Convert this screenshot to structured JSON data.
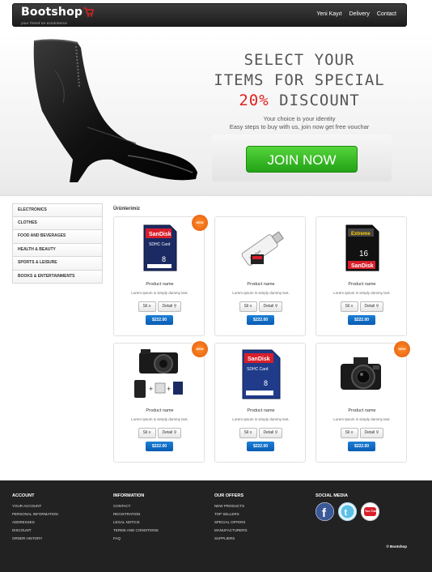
{
  "navbar": {
    "brand": "Bootshop",
    "tagline": "your friend on ecommerce",
    "links": [
      "Yeni Kayıt",
      "Delivery",
      "Contact"
    ]
  },
  "hero": {
    "line1": "SELECT YOUR",
    "line2": "ITEMS FOR SPECIAL",
    "line3_highlight": "20%",
    "line3_rest": " DISCOUNT",
    "sub1": "Your choice is your identity",
    "sub2": "Easy steps to buy with us, join now get free vouchar",
    "join_label": "JOIN NOW"
  },
  "sidebar": {
    "items": [
      "ELECTRONICS",
      "CLOTHES",
      "FOOD AND BEVERAGES",
      "HEALTH & BEAUTY",
      "SPORTS & LEISURE",
      "BOOKS & ENTERTAINMENTS"
    ]
  },
  "products": {
    "title": "Ürünlerimiz",
    "new_label": "NEW",
    "items": [
      {
        "name": "Product name",
        "desc": "Lorem Ipsum is simply dummy text.",
        "sil": "Sil",
        "detail": "Detail",
        "price": "$222.00",
        "new": true,
        "icon": "sd-card-icon"
      },
      {
        "name": "Product name",
        "desc": "Lorem Ipsum is simply dummy text.",
        "sil": "Sil",
        "detail": "Detail",
        "price": "$222.00",
        "new": false,
        "icon": "card-reader-icon"
      },
      {
        "name": "Product name",
        "desc": "Lorem Ipsum is simply dummy text.",
        "sil": "Sil",
        "detail": "Detail",
        "price": "$222.00",
        "new": false,
        "icon": "sd-card-extreme-icon"
      },
      {
        "name": "Product name",
        "desc": "Lorem Ipsum is simply dummy text.",
        "sil": "Sil",
        "detail": "Detail",
        "price": "$222.00",
        "new": true,
        "icon": "camera-kit-icon"
      },
      {
        "name": "Product name",
        "desc": "Lorem Ipsum is simply dummy text.",
        "sil": "Sil",
        "detail": "Detail",
        "price": "$222.00",
        "new": false,
        "icon": "sdhc-card-icon"
      },
      {
        "name": "Product name",
        "desc": "Lorem Ipsum is simply dummy text.",
        "sil": "Sil",
        "detail": "Detail",
        "price": "$222.00",
        "new": true,
        "icon": "camera-icon"
      }
    ]
  },
  "footer": {
    "account": {
      "title": "ACCOUNT",
      "links": [
        "YOUR ACCOUNT",
        "PERSONAL INFORMATION",
        "ADDRESSES",
        "DISCOUNT",
        "ORDER HISTORY"
      ]
    },
    "information": {
      "title": "INFORMATION",
      "links": [
        "CONTACT",
        "REGISTRATION",
        "LEGAL NOTICE",
        "TERMS AND CONDITIONS",
        "FAQ"
      ]
    },
    "offers": {
      "title": "OUR OFFERS",
      "links": [
        "NEW PRODUCTS",
        "TOP SELLERS",
        "SPECIAL OFFERS",
        "MANUFACTURERS",
        "SUPPLIERS"
      ]
    },
    "social": {
      "title": "SOCIAL MEDIA",
      "youtube_text": "You Tube"
    },
    "copyright": "© Bootshop"
  },
  "colors": {
    "accent_red": "#e02020",
    "join_green": "#2fb820",
    "price_blue": "#0a5cb3",
    "new_orange": "#f07a1c",
    "footer_bg": "#222222"
  }
}
